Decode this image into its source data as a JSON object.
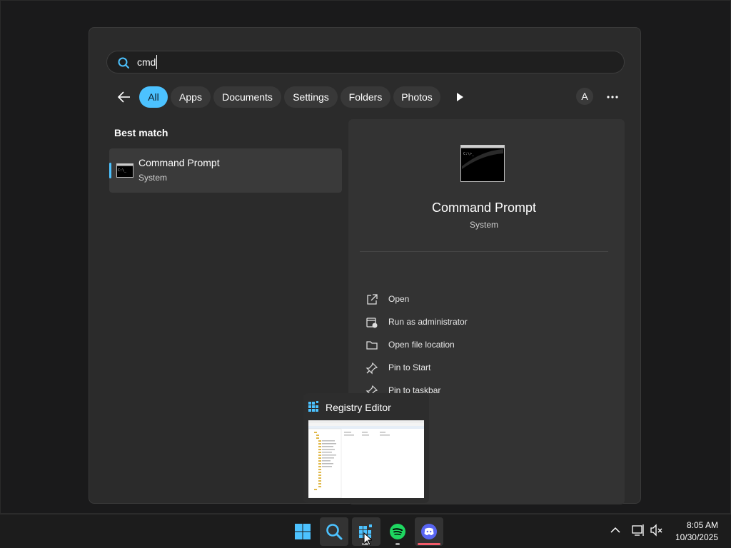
{
  "search": {
    "value": "cmd"
  },
  "filters": {
    "items": [
      {
        "label": "All",
        "active": true
      },
      {
        "label": "Apps"
      },
      {
        "label": "Documents"
      },
      {
        "label": "Settings"
      },
      {
        "label": "Folders"
      },
      {
        "label": "Photos"
      }
    ],
    "avatar_letter": "A"
  },
  "best_match": {
    "section_title": "Best match",
    "title": "Command Prompt",
    "subtitle": "System"
  },
  "detail": {
    "title": "Command Prompt",
    "subtitle": "System",
    "actions": [
      {
        "label": "Open",
        "icon": "open-external-icon"
      },
      {
        "label": "Run as administrator",
        "icon": "admin-shield-icon"
      },
      {
        "label": "Open file location",
        "icon": "folder-icon"
      },
      {
        "label": "Pin to Start",
        "icon": "pin-icon"
      },
      {
        "label": "Pin to taskbar",
        "icon": "pin-icon"
      }
    ]
  },
  "thumbnail": {
    "title": "Registry Editor"
  },
  "taskbar": {
    "time": "8:05 AM",
    "date": "10/30/2025",
    "apps": [
      "start-icon",
      "search-icon",
      "registry-editor-icon",
      "spotify-icon",
      "discord-icon"
    ]
  },
  "colors": {
    "accent": "#4cc2ff",
    "panel": "#2b2b2b",
    "discord": "#5865f2",
    "spotify": "#1ed760"
  }
}
